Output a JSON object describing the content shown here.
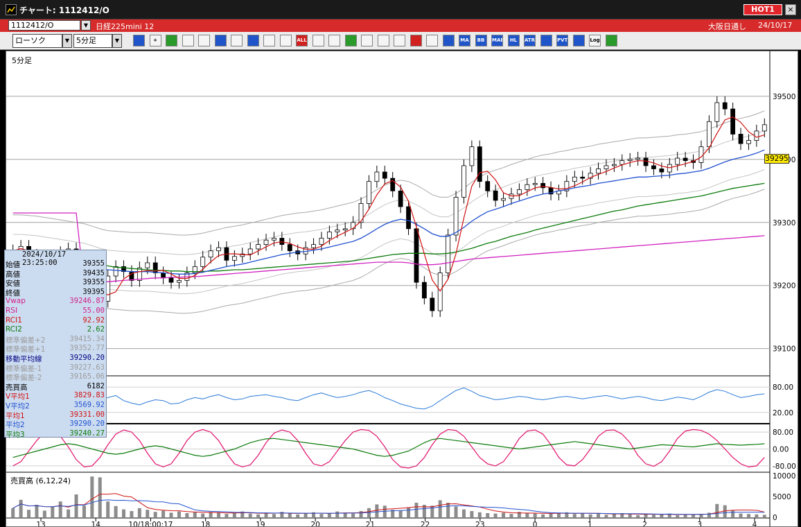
{
  "window": {
    "title": "チャート: 1112412/O",
    "hot_badge": "HOT1",
    "close": "×"
  },
  "symbolbar": {
    "symbol": "1112412/O",
    "instrument": "日経225mini 12",
    "session": "大阪日通し",
    "date": "24/10/17"
  },
  "toolbar": {
    "chart_type": "ローソク",
    "timeframe": "5分足",
    "buttons": [
      {
        "name": "zoom-icon",
        "label": "",
        "style": "blue"
      },
      {
        "name": "crosshair-icon",
        "label": "+",
        "style": ""
      },
      {
        "name": "draw-line-icon",
        "label": "",
        "style": "green"
      },
      {
        "name": "draw-arrow-icon",
        "label": "",
        "style": ""
      },
      {
        "name": "cursor-icon",
        "label": "",
        "style": ""
      },
      {
        "name": "undo-icon",
        "label": "",
        "style": "blue"
      },
      {
        "name": "memo-icon",
        "label": "",
        "style": ""
      },
      {
        "name": "trash-icon",
        "label": "",
        "style": "blue"
      },
      {
        "name": "candle-one-icon",
        "label": "",
        "style": ""
      },
      {
        "name": "candle-vol-icon",
        "label": "",
        "style": ""
      },
      {
        "name": "all-icon",
        "label": "ALL",
        "style": "red"
      },
      {
        "name": "settings-icon",
        "label": "",
        "style": ""
      },
      {
        "name": "tools-icon",
        "label": "",
        "style": ""
      },
      {
        "name": "palette-icon",
        "label": "",
        "style": "green"
      },
      {
        "name": "download-icon",
        "label": "",
        "style": ""
      },
      {
        "name": "search-chart-icon",
        "label": "",
        "style": ""
      },
      {
        "name": "compare-icon",
        "label": "",
        "style": ""
      },
      {
        "name": "plus-minus-icon",
        "label": "",
        "style": "red"
      },
      {
        "name": "lock-icon",
        "label": "",
        "style": ""
      },
      {
        "name": "volume-icon",
        "label": "",
        "style": "blue"
      },
      {
        "name": "ma-icon",
        "label": "MA",
        "style": "blue"
      },
      {
        "name": "bb-icon",
        "label": "BB",
        "style": "blue"
      },
      {
        "name": "mae-icon",
        "label": "MAE",
        "style": "blue"
      },
      {
        "name": "hl-icon",
        "label": "HL",
        "style": "blue"
      },
      {
        "name": "atr-icon",
        "label": "ATR",
        "style": "blue"
      },
      {
        "name": "kagi-icon",
        "label": "",
        "style": "blue"
      },
      {
        "name": "pvt-icon",
        "label": "PVT",
        "style": "blue"
      },
      {
        "name": "window-icon",
        "label": "",
        "style": "blue"
      },
      {
        "name": "log-icon",
        "label": "Log",
        "style": ""
      },
      {
        "name": "export-icon",
        "label": "",
        "style": "green"
      }
    ]
  },
  "chart": {
    "timeframe_label": "5分足",
    "volume_label": "売買高 (6,12,24)",
    "current_price": "39295"
  },
  "data_window": {
    "date": "2024/10/17  23:25:00",
    "rows": [
      {
        "k": "始値",
        "v": "39355",
        "color": "#000000"
      },
      {
        "k": "高値",
        "v": "39435",
        "color": "#000000"
      },
      {
        "k": "安値",
        "v": "39355",
        "color": "#000000"
      },
      {
        "k": "終値",
        "v": "39395",
        "color": "#000000"
      },
      {
        "k": "Vwap",
        "v": "39246.87",
        "color": "#d0208a"
      },
      {
        "k": "RSI",
        "v": "55.00",
        "color": "#d0208a"
      },
      {
        "k": "RCI1",
        "v": "92.92",
        "color": "#d01010"
      },
      {
        "k": "RCI2",
        "v": "2.62",
        "color": "#0a7a0a"
      },
      {
        "k": "標準偏差+2",
        "v": "39415.34",
        "color": "#9a9a9a"
      },
      {
        "k": "標準偏差+1",
        "v": "39352.77",
        "color": "#9a9a9a"
      },
      {
        "k": "移動平均線",
        "v": "39290.20",
        "color": "#000080"
      },
      {
        "k": "標準偏差-1",
        "v": "39227.63",
        "color": "#9a9a9a"
      },
      {
        "k": "標準偏差-2",
        "v": "39165.06",
        "color": "#9a9a9a"
      },
      {
        "k": "売買高",
        "v": "6182",
        "color": "#000000"
      },
      {
        "k": "V平均1",
        "v": "3829.83",
        "color": "#d01010"
      },
      {
        "k": "V平均2",
        "v": "3569.92",
        "color": "#2050d0"
      },
      {
        "k": "平均1",
        "v": "39331.00",
        "color": "#d01010"
      },
      {
        "k": "平均2",
        "v": "39290.20",
        "color": "#2050d0"
      },
      {
        "k": "平均3",
        "v": "39240.27",
        "color": "#0a7a0a"
      }
    ]
  },
  "chart_data": {
    "type": "line",
    "price_axis": {
      "ticks": [
        39500,
        39400,
        39300,
        39200,
        39100
      ]
    },
    "rsi_axis": {
      "ticks": [
        "80.00",
        "20.00"
      ]
    },
    "rci_axis": {
      "ticks": [
        "80.00",
        "0.00",
        "-80.00"
      ]
    },
    "volume_axis": {
      "ticks": [
        "10000",
        "5000",
        "0"
      ]
    },
    "x_ticks": [
      "13",
      "14",
      "10/18:00:17",
      "18",
      "19",
      "20",
      "21",
      "22",
      "23",
      "0",
      "1",
      "2",
      "3",
      "4"
    ],
    "close": [
      39255,
      39262,
      39248,
      39240,
      39230,
      39236,
      39252,
      39258,
      39246,
      39210,
      39140,
      39175,
      39215,
      39230,
      39222,
      39208,
      39228,
      39236,
      39220,
      39212,
      39205,
      39208,
      39220,
      39230,
      39245,
      39255,
      39260,
      39240,
      39246,
      39250,
      39258,
      39265,
      39272,
      39275,
      39265,
      39255,
      39250,
      39260,
      39265,
      39275,
      39285,
      39288,
      39290,
      39300,
      39330,
      39365,
      39380,
      39370,
      39350,
      39325,
      39290,
      39205,
      39180,
      39160,
      39220,
      39280,
      39340,
      39390,
      39420,
      39365,
      39350,
      39335,
      39338,
      39345,
      39352,
      39360,
      39362,
      39355,
      39345,
      39350,
      39365,
      39372,
      39370,
      39378,
      39385,
      39390,
      39392,
      39398,
      39400,
      39402,
      39390,
      39385,
      39380,
      39392,
      39402,
      39398,
      39395,
      39420,
      39460,
      39490,
      39480,
      39440,
      39425,
      39430,
      39445,
      39455
    ],
    "mid": [
      39250,
      39250,
      39249,
      39248,
      39246,
      39244,
      39242,
      39240,
      39238,
      39236,
      39232,
      39228,
      39225,
      39224,
      39223,
      39222,
      39222,
      39222,
      39221,
      39220,
      39219,
      39218,
      39218,
      39219,
      39221,
      39224,
      39227,
      39230,
      39232,
      39234,
      39237,
      39240,
      39243,
      39246,
      39249,
      39251,
      39253,
      39254,
      39256,
      39258,
      39261,
      39264,
      39267,
      39270,
      39275,
      39282,
      39290,
      39297,
      39302,
      39305,
      39303,
      39297,
      39290,
      39282,
      39278,
      39278,
      39284,
      39292,
      39302,
      39310,
      39317,
      39321,
      39325,
      39330,
      39334,
      39338,
      39342,
      39345,
      39347,
      39350,
      39352,
      39355,
      39357,
      39359,
      39362,
      39364,
      39366,
      39368,
      39370,
      39372,
      39372,
      39373,
      39374,
      39375,
      39377,
      39378,
      39380,
      39382,
      39386,
      39391,
      39396,
      39400,
      39403,
      39406,
      39410,
      39415
    ],
    "ma3": [
      39244,
      39244,
      39243,
      39243,
      39242,
      39241,
      39240,
      39239,
      39238,
      39237,
      39235,
      39233,
      39231,
      39229,
      39228,
      39227,
      39226,
      39225,
      39224,
      39224,
      39223,
      39223,
      39222,
      39222,
      39222,
      39223,
      39223,
      39224,
      39225,
      39225,
      39226,
      39227,
      39228,
      39229,
      39230,
      39231,
      39232,
      39233,
      39234,
      39235,
      39236,
      39237,
      39238,
      39239,
      39241,
      39243,
      39245,
      39247,
      39249,
      39250,
      39251,
      39251,
      39251,
      39250,
      39250,
      39251,
      39253,
      39256,
      39259,
      39263,
      39267,
      39270,
      39274,
      39278,
      39281,
      39284,
      39288,
      39291,
      39294,
      39297,
      39300,
      39303,
      39306,
      39309,
      39312,
      39315,
      39318,
      39320,
      39323,
      39326,
      39328,
      39330,
      39332,
      39334,
      39336,
      39338,
      39340,
      39342,
      39345,
      39348,
      39351,
      39354,
      39356,
      39358,
      39360,
      39362
    ],
    "vwap": [
      39315,
      39315,
      39315,
      39315,
      39315,
      39315,
      39315,
      39315,
      39315,
      39200,
      39202,
      39204,
      39206,
      39207,
      39208,
      39209,
      39210,
      39211,
      39212,
      39212,
      39213,
      39213,
      39214,
      39214,
      39215,
      39216,
      39217,
      39218,
      39219,
      39220,
      39221,
      39222,
      39223,
      39224,
      39225,
      39226,
      39227,
      39228,
      39229,
      39230,
      39231,
      39232,
      39233,
      39234,
      39235,
      39236,
      39237,
      39237,
      39237,
      39237,
      39236,
      39234,
      39233,
      39233,
      39234,
      39236,
      39238,
      39240,
      39242,
      39243,
      39244,
      39245,
      39246,
      39247,
      39248,
      39249,
      39250,
      39251,
      39252,
      39253,
      39254,
      39255,
      39256,
      39257,
      39258,
      39259,
      39260,
      39261,
      39262,
      39263,
      39264,
      39265,
      39266,
      39267,
      39268,
      39269,
      39270,
      39271,
      39272,
      39273,
      39274,
      39275,
      39276,
      39277,
      39278,
      39279
    ],
    "rsi": [
      45,
      40,
      35,
      30,
      38,
      45,
      55,
      50,
      42,
      35,
      40,
      50,
      55,
      60,
      48,
      42,
      38,
      45,
      50,
      48,
      40,
      42,
      50,
      55,
      52,
      58,
      62,
      55,
      50,
      52,
      58,
      60,
      62,
      58,
      55,
      50,
      48,
      55,
      62,
      66,
      60,
      55,
      58,
      62,
      68,
      72,
      65,
      55,
      48,
      40,
      35,
      30,
      28,
      35,
      48,
      60,
      72,
      78,
      70,
      60,
      55,
      50,
      52,
      55,
      58,
      56,
      52,
      50,
      53,
      56,
      58,
      55,
      52,
      55,
      58,
      60,
      56,
      52,
      55,
      58,
      55,
      50,
      48,
      52,
      56,
      54,
      50,
      58,
      68,
      74,
      70,
      62,
      55,
      58,
      62,
      64
    ],
    "rci1": [
      -80,
      -60,
      -10,
      40,
      80,
      85,
      60,
      10,
      -50,
      -85,
      -80,
      -40,
      20,
      70,
      90,
      80,
      40,
      -20,
      -70,
      -85,
      -70,
      -20,
      40,
      80,
      92,
      80,
      40,
      -20,
      -70,
      -85,
      -75,
      -30,
      30,
      75,
      90,
      80,
      40,
      -20,
      -70,
      -80,
      -60,
      -10,
      40,
      80,
      92,
      88,
      60,
      10,
      -50,
      -85,
      -90,
      -80,
      -40,
      20,
      70,
      92,
      88,
      60,
      10,
      -40,
      -70,
      -80,
      -60,
      -10,
      50,
      85,
      90,
      70,
      20,
      -40,
      -75,
      -80,
      -50,
      0,
      60,
      88,
      90,
      70,
      30,
      -30,
      -70,
      -82,
      -60,
      -10,
      50,
      85,
      92,
      88,
      70,
      40,
      0,
      -40,
      -70,
      -85,
      -80,
      -40
    ],
    "rci2": [
      -40,
      -30,
      -20,
      -10,
      0,
      10,
      20,
      25,
      20,
      10,
      0,
      -10,
      -20,
      -25,
      -20,
      -10,
      0,
      10,
      15,
      10,
      0,
      -10,
      -20,
      -30,
      -35,
      -30,
      -20,
      -10,
      0,
      15,
      30,
      40,
      48,
      50,
      45,
      40,
      35,
      30,
      25,
      20,
      15,
      10,
      5,
      0,
      -10,
      -20,
      -30,
      -35,
      -30,
      -20,
      -10,
      10,
      30,
      45,
      50,
      45,
      40,
      35,
      30,
      25,
      20,
      15,
      10,
      5,
      0,
      5,
      10,
      15,
      20,
      25,
      30,
      35,
      30,
      25,
      20,
      15,
      10,
      5,
      0,
      5,
      10,
      15,
      20,
      18,
      15,
      12,
      10,
      15,
      20,
      25,
      22,
      20,
      18,
      20,
      22,
      25
    ],
    "volume": [
      2200,
      4200,
      1800,
      3000,
      1600,
      2500,
      3800,
      1900,
      5500,
      2800,
      9800,
      9600,
      3800,
      2700,
      1900,
      1500,
      2200,
      1800,
      1300,
      1600,
      1100,
      1400,
      1000,
      1200,
      900,
      1300,
      1100,
      800,
      1000,
      1400,
      900,
      700,
      1100,
      800,
      1300,
      1000,
      700,
      900,
      1200,
      800,
      1000,
      1400,
      1100,
      900,
      1500,
      2200,
      3100,
      2800,
      1800,
      1600,
      2400,
      3500,
      3000,
      2800,
      4100,
      3500,
      2600,
      1900,
      1500,
      1200,
      1000,
      900,
      1100,
      800,
      1300,
      1000,
      900,
      700,
      900,
      1100,
      1200,
      800,
      1000,
      700,
      900,
      600,
      800,
      1000,
      700,
      500,
      800,
      600,
      700,
      900,
      500,
      600,
      700,
      800,
      1100,
      3200,
      2900,
      1600,
      900,
      800,
      700,
      600
    ]
  }
}
